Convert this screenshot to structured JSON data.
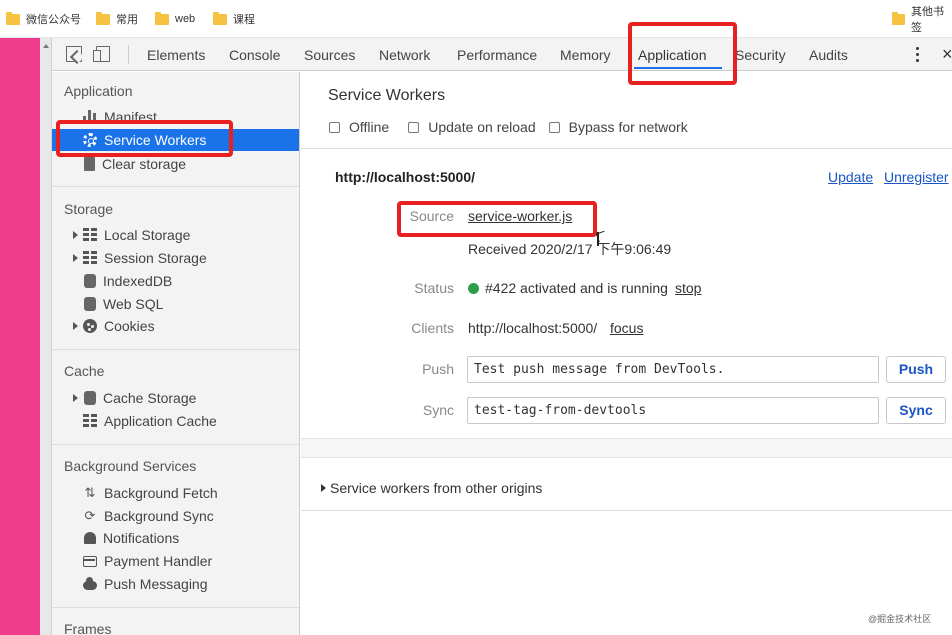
{
  "bookmarks": [
    {
      "label": "微信公众号"
    },
    {
      "label": "常用"
    },
    {
      "label": "web"
    },
    {
      "label": "课程"
    },
    {
      "label": "其他书签"
    }
  ],
  "toolbar": {
    "tabs": [
      {
        "label": "Elements"
      },
      {
        "label": "Console"
      },
      {
        "label": "Sources"
      },
      {
        "label": "Network"
      },
      {
        "label": "Performance"
      },
      {
        "label": "Memory"
      },
      {
        "label": "Application",
        "active": true
      },
      {
        "label": "Security"
      },
      {
        "label": "Audits"
      }
    ],
    "close_glyph": "×"
  },
  "sidebar": {
    "application": {
      "title": "Application",
      "items": [
        {
          "label": "Manifest",
          "icon": "bars-icon"
        },
        {
          "label": "Service Workers",
          "icon": "gear-icon",
          "selected": true
        },
        {
          "label": "Clear storage",
          "icon": "document-icon"
        }
      ]
    },
    "storage": {
      "title": "Storage",
      "items": [
        {
          "label": "Local Storage",
          "icon": "grid-icon",
          "expandable": true
        },
        {
          "label": "Session Storage",
          "icon": "grid-icon",
          "expandable": true
        },
        {
          "label": "IndexedDB",
          "icon": "database-icon"
        },
        {
          "label": "Web SQL",
          "icon": "database-icon"
        },
        {
          "label": "Cookies",
          "icon": "cookie-icon",
          "expandable": true
        }
      ]
    },
    "cache": {
      "title": "Cache",
      "items": [
        {
          "label": "Cache Storage",
          "icon": "database-icon",
          "expandable": true
        },
        {
          "label": "Application Cache",
          "icon": "grid-icon"
        }
      ]
    },
    "background": {
      "title": "Background Services",
      "items": [
        {
          "label": "Background Fetch",
          "icon": "fetch-arrows-icon"
        },
        {
          "label": "Background Sync",
          "icon": "sync-icon"
        },
        {
          "label": "Notifications",
          "icon": "bell-icon"
        },
        {
          "label": "Payment Handler",
          "icon": "card-icon"
        },
        {
          "label": "Push Messaging",
          "icon": "cloud-icon"
        }
      ]
    },
    "frames": {
      "title": "Frames"
    }
  },
  "main": {
    "title": "Service Workers",
    "options": [
      {
        "label": "Offline",
        "checked": false
      },
      {
        "label": "Update on reload",
        "checked": false
      },
      {
        "label": "Bypass for network",
        "checked": false
      }
    ],
    "origin": "http://localhost:5000/",
    "update_label": "Update",
    "unregister_label": "Unregister",
    "source": {
      "label": "Source",
      "value": "service-worker.js",
      "received": "Received 2020/2/17 下午9:06:49"
    },
    "status": {
      "label": "Status",
      "value": "#422 activated and is running",
      "action": "stop",
      "color": "#2e9e4b"
    },
    "clients": {
      "label": "Clients",
      "value": "http://localhost:5000/",
      "action": "focus"
    },
    "push": {
      "label": "Push",
      "input_value": "Test push message from DevTools.",
      "button": "Push"
    },
    "sync": {
      "label": "Sync",
      "input_value": "test-tag-from-devtools",
      "button": "Sync"
    },
    "other_origins": "Service workers from other origins"
  },
  "watermark": "@掘金技术社区",
  "colors": {
    "accent": "#1a73e8",
    "highlight": "#e8201f",
    "pink": "#ef3d8e"
  }
}
